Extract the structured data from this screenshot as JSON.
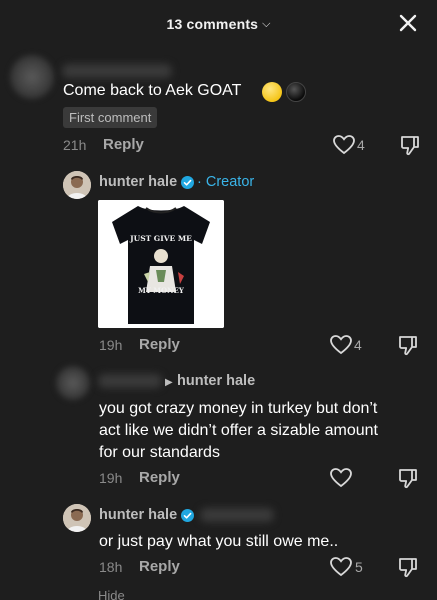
{
  "header": {
    "title": "13 comments",
    "chevron_icon": "chevron-down-icon",
    "close_icon": "close-icon"
  },
  "comments": [
    {
      "text": "Come back to Aek GOAT",
      "emojis": [
        "yellow-circle",
        "black-circle"
      ],
      "badge": "First comment",
      "time": "21h",
      "reply_label": "Reply",
      "likes": "4"
    },
    {
      "username": "hunter hale",
      "verified": true,
      "creator_label": "· Creator",
      "image_caption_top": "JUST GIVE ME",
      "image_caption_bottom": "MY MONEY",
      "time": "19h",
      "reply_label": "Reply",
      "likes": "4"
    },
    {
      "reply_to": "hunter hale",
      "text_lines": [
        "you got crazy money in turkey but don’t",
        "act like we didn’t offer a sizable amount",
        "for our standards"
      ],
      "time": "19h",
      "reply_label": "Reply",
      "likes": ""
    },
    {
      "username": "hunter hale",
      "verified": true,
      "text": "or just pay what you still owe me..",
      "time": "18h",
      "reply_label": "Reply",
      "likes": "5"
    }
  ],
  "footer": {
    "hide_label": "Hide"
  },
  "colors": {
    "background": "#1e1e1e",
    "creator_accent": "#3ab4e8",
    "verified": "#20a7e0"
  }
}
